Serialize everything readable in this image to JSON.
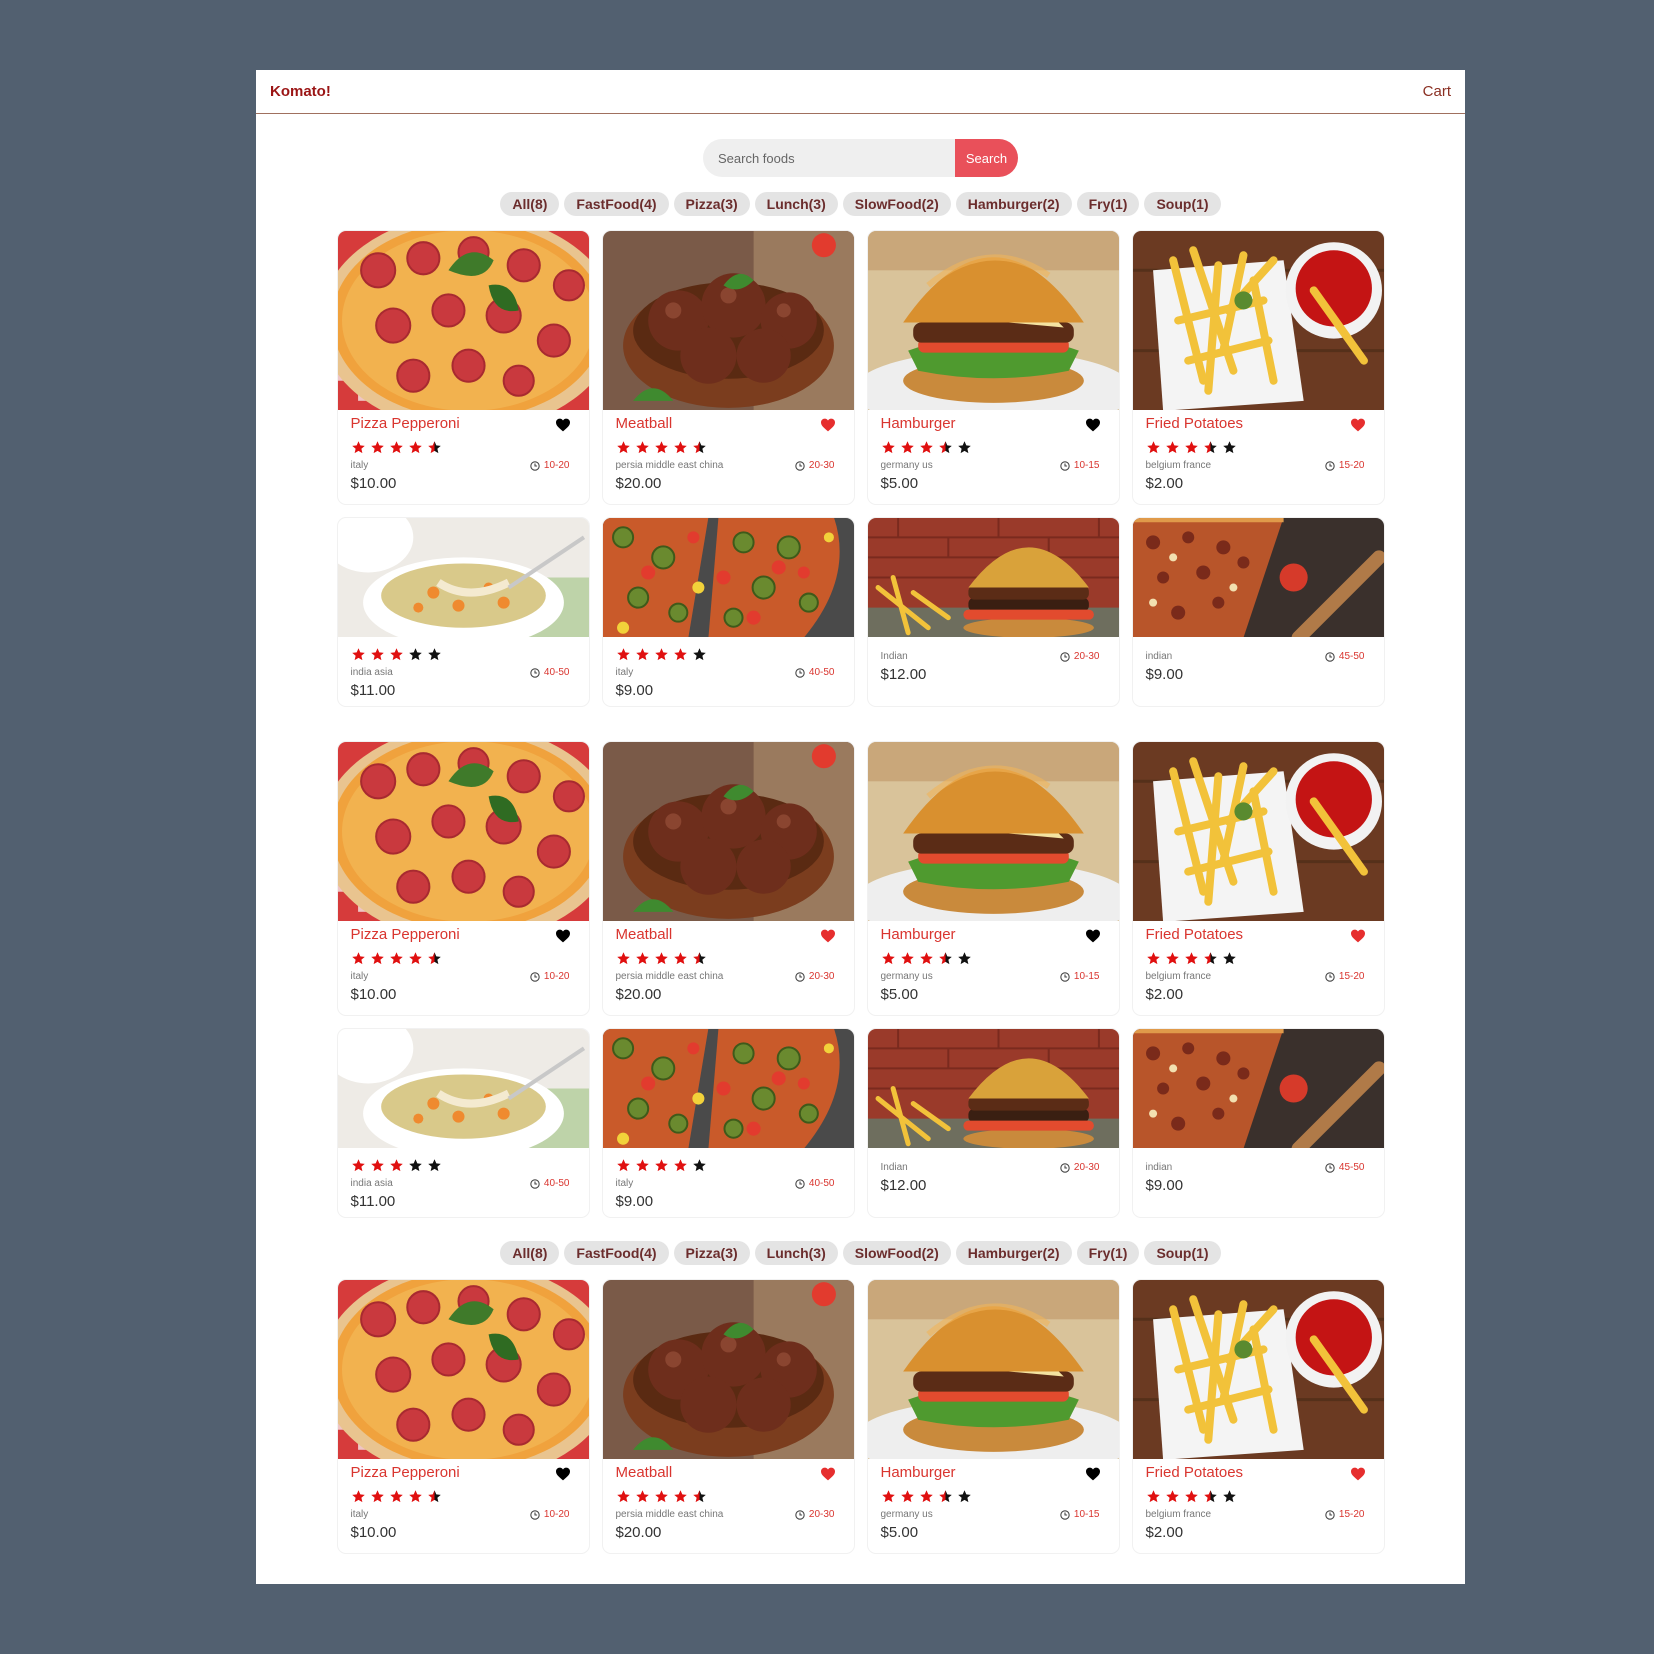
{
  "app": {
    "brand": "Komato!",
    "cart_label": "Cart"
  },
  "search": {
    "placeholder": "Search foods",
    "button_label": "Search"
  },
  "filters": [
    "All(8)",
    "FastFood(4)",
    "Pizza(3)",
    "Lunch(3)",
    "SlowFood(2)",
    "Hamburger(2)",
    "Fry(1)",
    "Soup(1)"
  ],
  "colors": {
    "accent": "#e9505a",
    "brand": "#9b1515",
    "title": "#d9352f",
    "background": "#526070"
  },
  "foods": [
    {
      "name": "Pizza Pepperoni",
      "rating": 4.5,
      "origin": "italy",
      "time": "10-20",
      "price": "$10.00",
      "favorite": false,
      "image": "pizza-pepperoni"
    },
    {
      "name": "Meatball",
      "rating": 4.5,
      "origin": "persia middle east china",
      "time": "20-30",
      "price": "$20.00",
      "favorite": true,
      "image": "meatballs"
    },
    {
      "name": "Hamburger",
      "rating": 3.5,
      "origin": "germany us",
      "time": "10-15",
      "price": "$5.00",
      "favorite": false,
      "image": "hamburger"
    },
    {
      "name": "Fried Potatoes",
      "rating": 3.5,
      "origin": "belgium france",
      "time": "15-20",
      "price": "$2.00",
      "favorite": true,
      "image": "fries"
    },
    {
      "name": "",
      "rating": 3,
      "origin": "india asia",
      "time": "40-50",
      "price": "$11.00",
      "favorite": null,
      "image": "soup"
    },
    {
      "name": "",
      "rating": 4,
      "origin": "italy",
      "time": "40-50",
      "price": "$9.00",
      "favorite": null,
      "image": "veggie-pizza"
    },
    {
      "name": "",
      "rating": null,
      "origin": "Indian",
      "time": "20-30",
      "price": "$12.00",
      "favorite": null,
      "image": "burger-fries"
    },
    {
      "name": "",
      "rating": null,
      "origin": "indian",
      "time": "45-50",
      "price": "$9.00",
      "favorite": null,
      "image": "pizza-slices"
    }
  ]
}
